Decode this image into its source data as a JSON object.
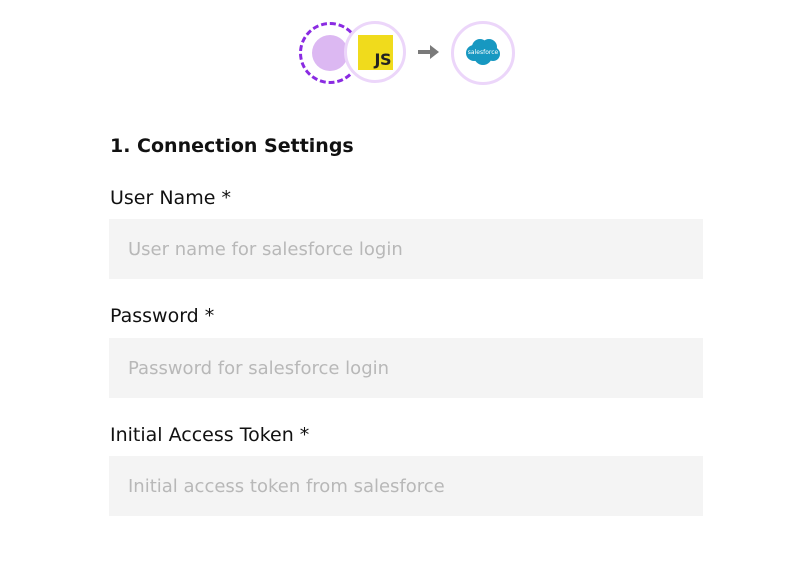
{
  "flow": {
    "nodes": [
      {
        "name": "trigger-placeholder",
        "icon": "dashed-circle-icon"
      },
      {
        "name": "javascript",
        "icon": "js-icon",
        "badge_text": "JS",
        "color": "#f0db1c"
      },
      {
        "name": "salesforce",
        "icon": "salesforce-cloud-icon",
        "logo_text": "salesforce",
        "color": "#1798c1"
      }
    ],
    "connector_icon": "arrow-right-icon",
    "accent_color": "#8a2be2"
  },
  "form": {
    "section_title": "1. Connection Settings",
    "fields": [
      {
        "label": "User Name *",
        "value": "",
        "placeholder": "User name for salesforce login"
      },
      {
        "label": "Password *",
        "value": "",
        "placeholder": "Password for salesforce login"
      },
      {
        "label": "Initial Access Token *",
        "value": "",
        "placeholder": "Initial access token from salesforce"
      }
    ]
  }
}
